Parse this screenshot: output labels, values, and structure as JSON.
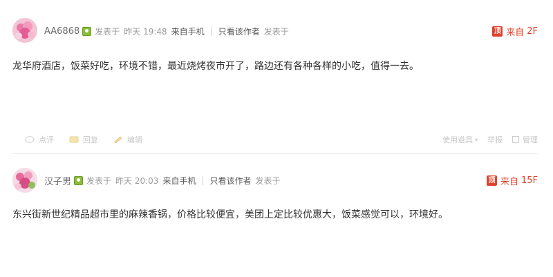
{
  "posts": [
    {
      "username": "AA6868",
      "posted_label": "发表于",
      "time": "昨天 19:48",
      "source": "来自手机",
      "sep": "|",
      "only_author": "只看该作者",
      "posted_label2": "发表于",
      "floor_icon": "顶",
      "floor_prefix": "来自",
      "floor": "2F",
      "content": "龙华府酒店，饭菜好吃，环境不错，最近烧烤夜市开了，路边还有各种各样的小吃，值得一去。",
      "actions": {
        "comment": "点评",
        "reply": "回复",
        "edit": "编辑",
        "tools": "使用道具",
        "report": "举报",
        "manage": "管理"
      }
    },
    {
      "username": "汉子男",
      "posted_label": "发表于",
      "time": "昨天 20:03",
      "source": "来自手机",
      "sep": "|",
      "only_author": "只看该作者",
      "posted_label2": "发表于",
      "floor_icon": "顶",
      "floor_prefix": "来自",
      "floor": "15F",
      "content": "东兴街新世纪精品超市里的麻辣香锅，价格比较便宜，美团上定比较优惠大，饭菜感觉可以，环境好。"
    }
  ],
  "colors": {
    "accent_red": "#e0422b",
    "badge_green": "#8bbd3a"
  },
  "icons": {
    "avatar": "avatar",
    "user_badge": "user-badge-icon",
    "floor": "floor-icon",
    "comment": "comment-icon",
    "reply": "reply-icon",
    "edit": "edit-icon"
  }
}
